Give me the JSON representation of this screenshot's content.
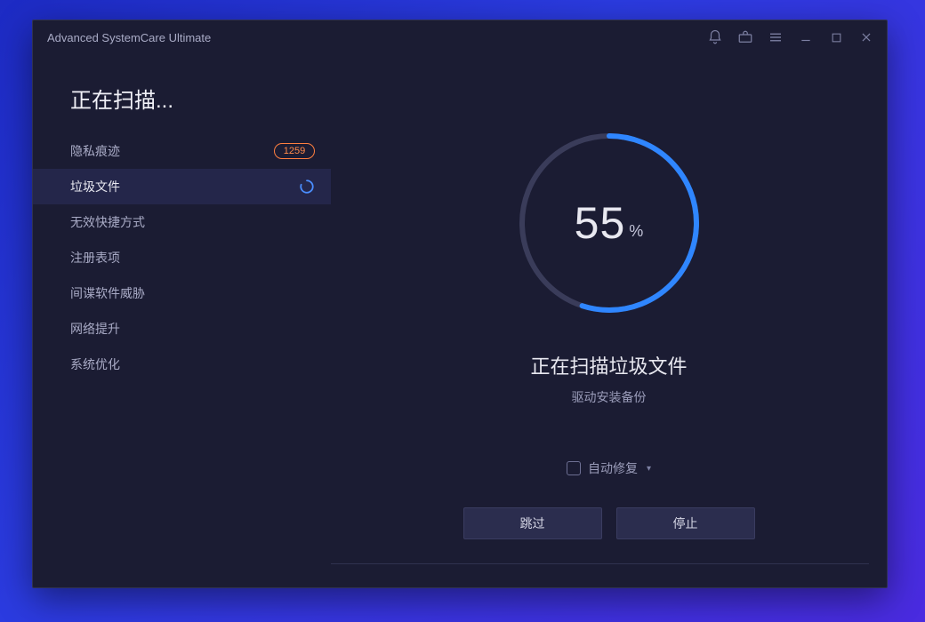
{
  "window": {
    "title": "Advanced SystemCare Ultimate"
  },
  "sidebar": {
    "heading": "正在扫描...",
    "items": [
      {
        "label": "隐私痕迹",
        "badge": "1259",
        "state": "done"
      },
      {
        "label": "垃圾文件",
        "state": "active"
      },
      {
        "label": "无效快捷方式",
        "state": "pending"
      },
      {
        "label": "注册表项",
        "state": "pending"
      },
      {
        "label": "间谍软件威胁",
        "state": "pending"
      },
      {
        "label": "网络提升",
        "state": "pending"
      },
      {
        "label": "系统优化",
        "state": "pending"
      }
    ]
  },
  "scan": {
    "percent_value": "55",
    "percent_symbol": "%",
    "percent_numeric": 55,
    "status_text": "正在扫描垃圾文件",
    "detail_text": "驱动安装备份"
  },
  "autofix": {
    "label": "自动修复",
    "checked": false
  },
  "buttons": {
    "skip": "跳过",
    "stop": "停止"
  },
  "colors": {
    "accent": "#2f86ff",
    "ring_track": "#3a3c5a",
    "badge": "#ff8a4a"
  }
}
